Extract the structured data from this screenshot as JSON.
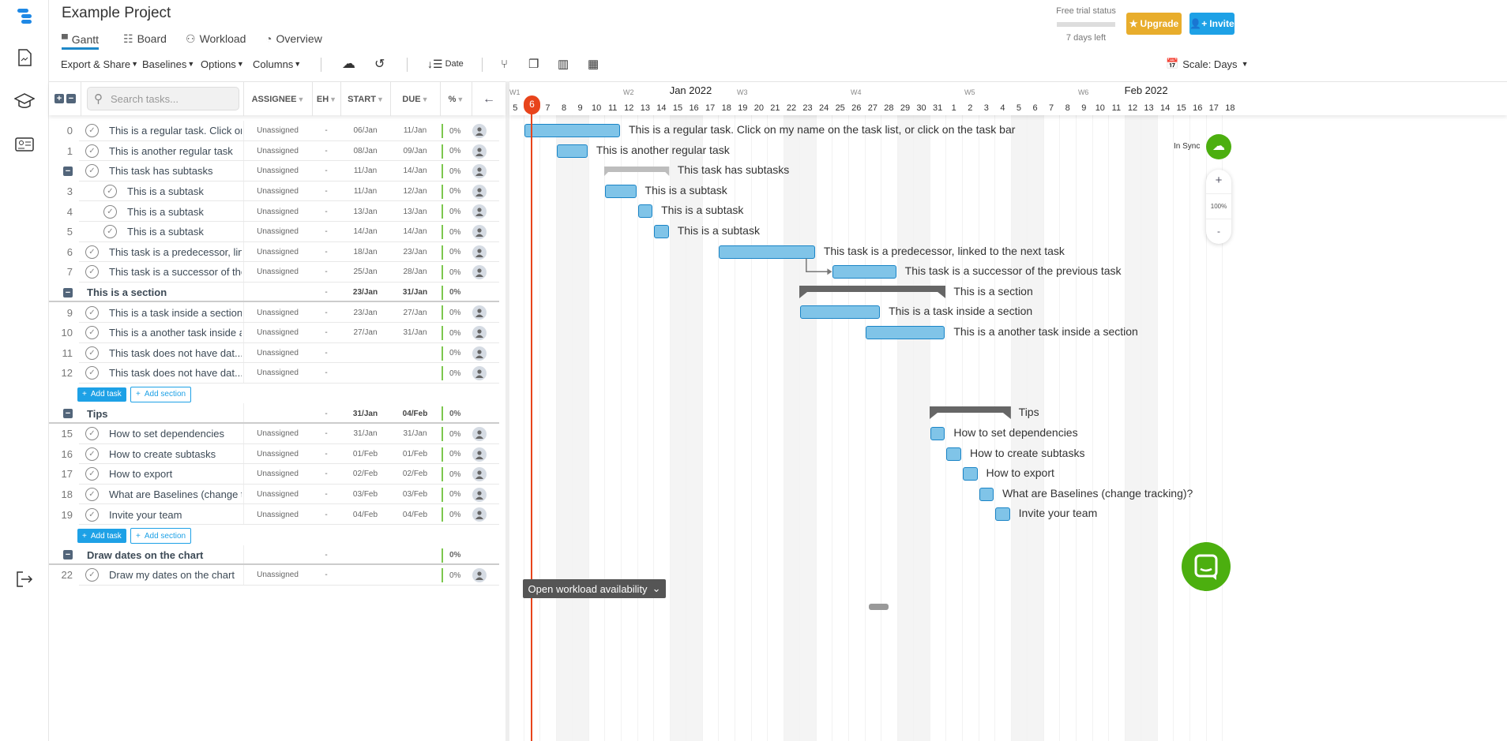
{
  "app": {
    "title": "Example Project",
    "brand_color": "#1e88e5"
  },
  "rail": {
    "icons": [
      "logo-icon",
      "document-icon",
      "graduation-cap-icon",
      "contact-card-icon",
      "logout-icon"
    ]
  },
  "tabs": [
    {
      "label": "Gantt",
      "icon": "gantt-icon",
      "active": true
    },
    {
      "label": "Board",
      "icon": "board-icon"
    },
    {
      "label": "Workload",
      "icon": "users-icon"
    },
    {
      "label": "Overview",
      "icon": "gauge-icon"
    }
  ],
  "toolbar": {
    "export": "Export & Share",
    "baselines": "Baselines",
    "options": "Options",
    "columns": "Columns",
    "sort": "Date",
    "scale": "Scale: Days"
  },
  "trial": {
    "label": "Free trial status",
    "days_left": "7 days left",
    "progress": 0
  },
  "buttons": {
    "upgrade": "Upgrade",
    "invite": "Invite",
    "upgrade_color": "#e8ad2c",
    "invite_color": "#1ea1e6"
  },
  "table": {
    "search_placeholder": "Search tasks...",
    "columns": [
      "ASSIGNEE",
      "EH",
      "START",
      "DUE",
      "%"
    ]
  },
  "rows": [
    {
      "type": "task",
      "num": "0",
      "name": "This is a regular task. Click on my name on the task list, or click on the task bar",
      "assignee": "Unassigned",
      "eh": "-",
      "start": "06/Jan",
      "due": "11/Jan",
      "pct": "0%"
    },
    {
      "type": "task",
      "num": "1",
      "name": "This is another regular task",
      "assignee": "Unassigned",
      "eh": "-",
      "start": "08/Jan",
      "due": "09/Jan",
      "pct": "0%"
    },
    {
      "type": "parent",
      "num": "",
      "name": "This task has subtasks",
      "assignee": "Unassigned",
      "eh": "-",
      "start": "11/Jan",
      "due": "14/Jan",
      "pct": "0%"
    },
    {
      "type": "subtask",
      "num": "3",
      "name": "This is a subtask",
      "assignee": "Unassigned",
      "eh": "-",
      "start": "11/Jan",
      "due": "12/Jan",
      "pct": "0%"
    },
    {
      "type": "subtask",
      "num": "4",
      "name": "This is a subtask",
      "assignee": "Unassigned",
      "eh": "-",
      "start": "13/Jan",
      "due": "13/Jan",
      "pct": "0%"
    },
    {
      "type": "subtask",
      "num": "5",
      "name": "This is a subtask",
      "assignee": "Unassigned",
      "eh": "-",
      "start": "14/Jan",
      "due": "14/Jan",
      "pct": "0%"
    },
    {
      "type": "task",
      "num": "6",
      "name": "This task is a predecessor, linked to the next task",
      "assignee": "Unassigned",
      "eh": "-",
      "start": "18/Jan",
      "due": "23/Jan",
      "pct": "0%"
    },
    {
      "type": "task",
      "num": "7",
      "name": "This task is a successor of the previous task",
      "assignee": "Unassigned",
      "eh": "-",
      "start": "25/Jan",
      "due": "28/Jan",
      "pct": "0%"
    },
    {
      "type": "section",
      "num": "",
      "name": "This is a section",
      "eh": "-",
      "start": "23/Jan",
      "due": "31/Jan",
      "pct": "0%"
    },
    {
      "type": "task",
      "num": "9",
      "name": "This is a task inside a section",
      "assignee": "Unassigned",
      "eh": "-",
      "start": "23/Jan",
      "due": "27/Jan",
      "pct": "0%"
    },
    {
      "type": "task",
      "num": "10",
      "name": "This is a another task inside a section",
      "assignee": "Unassigned",
      "eh": "-",
      "start": "27/Jan",
      "due": "31/Jan",
      "pct": "0%"
    },
    {
      "type": "task",
      "num": "11",
      "name": "This task does not have dat...",
      "assignee": "Unassigned",
      "eh": "-",
      "start": "",
      "due": "",
      "pct": "0%"
    },
    {
      "type": "task",
      "num": "12",
      "name": "This task does not have dat...",
      "assignee": "Unassigned",
      "eh": "-",
      "start": "",
      "due": "",
      "pct": "0%"
    },
    {
      "type": "add",
      "add_task": "Add task",
      "add_section": "Add section"
    },
    {
      "type": "section",
      "num": "",
      "name": "Tips",
      "eh": "-",
      "start": "31/Jan",
      "due": "04/Feb",
      "pct": "0%"
    },
    {
      "type": "task",
      "num": "15",
      "name": "How to set dependencies",
      "assignee": "Unassigned",
      "eh": "-",
      "start": "31/Jan",
      "due": "31/Jan",
      "pct": "0%"
    },
    {
      "type": "task",
      "num": "16",
      "name": "How to create subtasks",
      "assignee": "Unassigned",
      "eh": "-",
      "start": "01/Feb",
      "due": "01/Feb",
      "pct": "0%"
    },
    {
      "type": "task",
      "num": "17",
      "name": "How to export",
      "assignee": "Unassigned",
      "eh": "-",
      "start": "02/Feb",
      "due": "02/Feb",
      "pct": "0%"
    },
    {
      "type": "task",
      "num": "18",
      "name": "What are Baselines (change tracking)?",
      "assignee": "Unassigned",
      "eh": "-",
      "start": "03/Feb",
      "due": "03/Feb",
      "pct": "0%"
    },
    {
      "type": "task",
      "num": "19",
      "name": "Invite your team",
      "assignee": "Unassigned",
      "eh": "-",
      "start": "04/Feb",
      "due": "04/Feb",
      "pct": "0%"
    },
    {
      "type": "add",
      "add_task": "Add task",
      "add_section": "Add section"
    },
    {
      "type": "section",
      "num": "",
      "name": "Draw dates on the chart",
      "eh": "-",
      "start": "",
      "due": "",
      "pct": "0%"
    },
    {
      "type": "task",
      "num": "22",
      "name": "Draw my dates on the chart",
      "assignee": "Unassigned",
      "eh": "-",
      "start": "",
      "due": "",
      "pct": "0%"
    }
  ],
  "timeline": {
    "months": [
      {
        "label": "Jan 2022",
        "day": "15/Jan"
      },
      {
        "label": "Feb 2022",
        "day": "12/Feb"
      }
    ],
    "weeks": [
      {
        "label": "W1",
        "day": "05/Jan"
      },
      {
        "label": "W2",
        "day": "12/Jan"
      },
      {
        "label": "W3",
        "day": "19/Jan"
      },
      {
        "label": "W4",
        "day": "26/Jan"
      },
      {
        "label": "W5",
        "day": "02/Feb"
      },
      {
        "label": "W6",
        "day": "09/Feb"
      }
    ],
    "first_day": "05/Jan",
    "last_day": "18/Feb",
    "today": "6",
    "today_date": "06/Jan",
    "weekends": [
      "08/Jan",
      "09/Jan",
      "15/Jan",
      "16/Jan",
      "22/Jan",
      "23/Jan",
      "29/Jan",
      "30/Jan",
      "05/Feb",
      "06/Feb",
      "12/Feb",
      "13/Feb"
    ],
    "dependencies": [
      {
        "from": 6,
        "to": 7
      }
    ]
  },
  "sync": {
    "label": "In Sync",
    "color": "#4caf0f"
  },
  "zoom": {
    "plus": "+",
    "level": "100%",
    "minus": "-"
  },
  "workload_button": "Open workload availability"
}
